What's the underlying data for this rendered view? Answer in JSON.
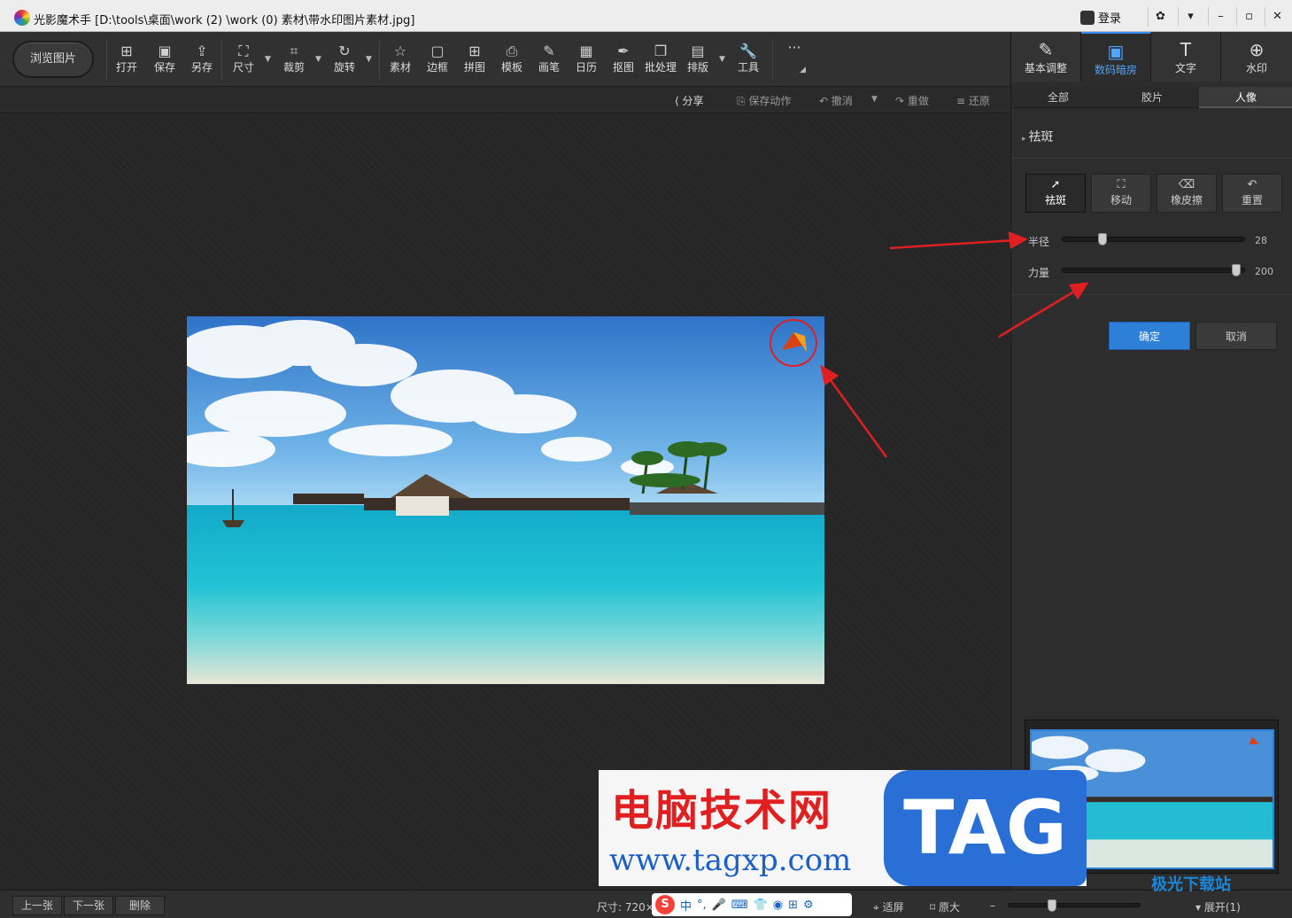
{
  "window": {
    "title": "光影魔术手  [D:\\tools\\桌面\\work (2) \\work (0) 素材\\带水印图片素材.jpg]",
    "login": "登录"
  },
  "toolbar": {
    "browse": "浏览图片",
    "items": [
      "打开",
      "保存",
      "另存",
      "尺寸",
      "裁剪",
      "旋转",
      "素材",
      "边框",
      "拼图",
      "模板",
      "画笔",
      "日历",
      "抠图",
      "批处理",
      "排版",
      "工具"
    ]
  },
  "subtoolbar": {
    "share": "分享",
    "save_action": "保存动作",
    "undo": "撤消",
    "redo": "重做",
    "restore": "还原"
  },
  "right_panel": {
    "tabs": [
      "基本调整",
      "数码暗房",
      "文字",
      "水印"
    ],
    "categories": [
      "全部",
      "胶片",
      "人像"
    ],
    "section_title": "祛斑",
    "tools": [
      "祛斑",
      "移动",
      "橡皮擦",
      "重置"
    ],
    "radius_label": "半径",
    "radius_value": "28",
    "radius_level": 0.15,
    "strength_label": "力量",
    "strength_value": "200",
    "strength_level": 1.0,
    "ok": "确定",
    "cancel": "取消"
  },
  "statusbar": {
    "prev": "上一张",
    "next": "下一张",
    "delete": "删除",
    "size": "尺寸: 720×",
    "fit": "适屏",
    "original": "原大",
    "expand": "展开(1)"
  },
  "ime": {
    "logo": "S",
    "lang": "中"
  },
  "watermark": {
    "cn": "电脑技术网",
    "url": "www.tagxp.com",
    "tag": "TAG",
    "site2": "极光下载站"
  },
  "colors": {
    "accent": "#2e7fd6",
    "annotation": "#e02020"
  }
}
